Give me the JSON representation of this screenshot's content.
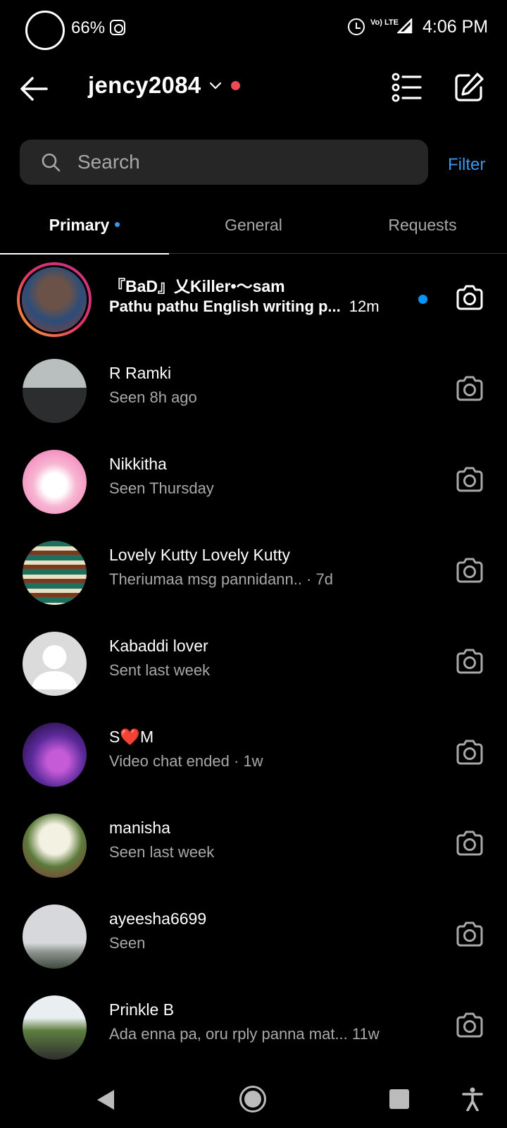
{
  "status_bar": {
    "battery": "66%",
    "volte": "Vo) LTE",
    "time": "4:06 PM"
  },
  "header": {
    "account_name": "jency2084"
  },
  "search": {
    "placeholder": "Search",
    "filter_label": "Filter"
  },
  "tabs": [
    {
      "label": "Primary",
      "active": true
    },
    {
      "label": "General",
      "active": false
    },
    {
      "label": "Requests",
      "active": false
    }
  ],
  "chats": [
    {
      "name": "『BaD』乂Killer•〜sam",
      "preview": "Pathu pathu English writing p...",
      "time": "12m",
      "unread": true
    },
    {
      "name": "R Ramki",
      "preview": "Seen 8h ago",
      "time": ""
    },
    {
      "name": "Nikkitha",
      "preview": "Seen Thursday",
      "time": ""
    },
    {
      "name": "Lovely Kutty Lovely Kutty",
      "preview": "Theriumaa msg pannidann..",
      "time": " · 7d"
    },
    {
      "name": "Kabaddi lover",
      "preview": "Sent last week",
      "time": ""
    },
    {
      "name": "S❤️M",
      "preview": "Video chat ended",
      "time": " · 1w"
    },
    {
      "name": "manisha",
      "preview": "Seen last week",
      "time": ""
    },
    {
      "name": "ayeesha6699",
      "preview": "Seen",
      "time": ""
    },
    {
      "name": "Prinkle B",
      "preview": "Ada enna pa, oru rply panna mat...",
      "time": "  11w"
    }
  ],
  "colors": {
    "accent_blue": "#3897f0",
    "unread_dot": "#0095f6",
    "status_red": "#ed4956",
    "background": "#000000"
  }
}
